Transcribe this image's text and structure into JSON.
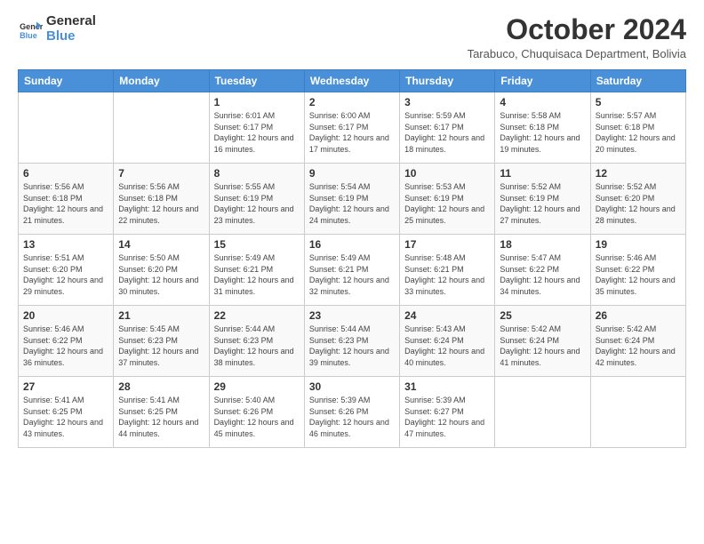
{
  "logo": {
    "line1": "General",
    "line2": "Blue"
  },
  "header": {
    "month": "October 2024",
    "subtitle": "Tarabuco, Chuquisaca Department, Bolivia"
  },
  "weekdays": [
    "Sunday",
    "Monday",
    "Tuesday",
    "Wednesday",
    "Thursday",
    "Friday",
    "Saturday"
  ],
  "weeks": [
    [
      {
        "day": "",
        "sunrise": "",
        "sunset": "",
        "daylight": ""
      },
      {
        "day": "",
        "sunrise": "",
        "sunset": "",
        "daylight": ""
      },
      {
        "day": "1",
        "sunrise": "Sunrise: 6:01 AM",
        "sunset": "Sunset: 6:17 PM",
        "daylight": "Daylight: 12 hours and 16 minutes."
      },
      {
        "day": "2",
        "sunrise": "Sunrise: 6:00 AM",
        "sunset": "Sunset: 6:17 PM",
        "daylight": "Daylight: 12 hours and 17 minutes."
      },
      {
        "day": "3",
        "sunrise": "Sunrise: 5:59 AM",
        "sunset": "Sunset: 6:17 PM",
        "daylight": "Daylight: 12 hours and 18 minutes."
      },
      {
        "day": "4",
        "sunrise": "Sunrise: 5:58 AM",
        "sunset": "Sunset: 6:18 PM",
        "daylight": "Daylight: 12 hours and 19 minutes."
      },
      {
        "day": "5",
        "sunrise": "Sunrise: 5:57 AM",
        "sunset": "Sunset: 6:18 PM",
        "daylight": "Daylight: 12 hours and 20 minutes."
      }
    ],
    [
      {
        "day": "6",
        "sunrise": "Sunrise: 5:56 AM",
        "sunset": "Sunset: 6:18 PM",
        "daylight": "Daylight: 12 hours and 21 minutes."
      },
      {
        "day": "7",
        "sunrise": "Sunrise: 5:56 AM",
        "sunset": "Sunset: 6:18 PM",
        "daylight": "Daylight: 12 hours and 22 minutes."
      },
      {
        "day": "8",
        "sunrise": "Sunrise: 5:55 AM",
        "sunset": "Sunset: 6:19 PM",
        "daylight": "Daylight: 12 hours and 23 minutes."
      },
      {
        "day": "9",
        "sunrise": "Sunrise: 5:54 AM",
        "sunset": "Sunset: 6:19 PM",
        "daylight": "Daylight: 12 hours and 24 minutes."
      },
      {
        "day": "10",
        "sunrise": "Sunrise: 5:53 AM",
        "sunset": "Sunset: 6:19 PM",
        "daylight": "Daylight: 12 hours and 25 minutes."
      },
      {
        "day": "11",
        "sunrise": "Sunrise: 5:52 AM",
        "sunset": "Sunset: 6:19 PM",
        "daylight": "Daylight: 12 hours and 27 minutes."
      },
      {
        "day": "12",
        "sunrise": "Sunrise: 5:52 AM",
        "sunset": "Sunset: 6:20 PM",
        "daylight": "Daylight: 12 hours and 28 minutes."
      }
    ],
    [
      {
        "day": "13",
        "sunrise": "Sunrise: 5:51 AM",
        "sunset": "Sunset: 6:20 PM",
        "daylight": "Daylight: 12 hours and 29 minutes."
      },
      {
        "day": "14",
        "sunrise": "Sunrise: 5:50 AM",
        "sunset": "Sunset: 6:20 PM",
        "daylight": "Daylight: 12 hours and 30 minutes."
      },
      {
        "day": "15",
        "sunrise": "Sunrise: 5:49 AM",
        "sunset": "Sunset: 6:21 PM",
        "daylight": "Daylight: 12 hours and 31 minutes."
      },
      {
        "day": "16",
        "sunrise": "Sunrise: 5:49 AM",
        "sunset": "Sunset: 6:21 PM",
        "daylight": "Daylight: 12 hours and 32 minutes."
      },
      {
        "day": "17",
        "sunrise": "Sunrise: 5:48 AM",
        "sunset": "Sunset: 6:21 PM",
        "daylight": "Daylight: 12 hours and 33 minutes."
      },
      {
        "day": "18",
        "sunrise": "Sunrise: 5:47 AM",
        "sunset": "Sunset: 6:22 PM",
        "daylight": "Daylight: 12 hours and 34 minutes."
      },
      {
        "day": "19",
        "sunrise": "Sunrise: 5:46 AM",
        "sunset": "Sunset: 6:22 PM",
        "daylight": "Daylight: 12 hours and 35 minutes."
      }
    ],
    [
      {
        "day": "20",
        "sunrise": "Sunrise: 5:46 AM",
        "sunset": "Sunset: 6:22 PM",
        "daylight": "Daylight: 12 hours and 36 minutes."
      },
      {
        "day": "21",
        "sunrise": "Sunrise: 5:45 AM",
        "sunset": "Sunset: 6:23 PM",
        "daylight": "Daylight: 12 hours and 37 minutes."
      },
      {
        "day": "22",
        "sunrise": "Sunrise: 5:44 AM",
        "sunset": "Sunset: 6:23 PM",
        "daylight": "Daylight: 12 hours and 38 minutes."
      },
      {
        "day": "23",
        "sunrise": "Sunrise: 5:44 AM",
        "sunset": "Sunset: 6:23 PM",
        "daylight": "Daylight: 12 hours and 39 minutes."
      },
      {
        "day": "24",
        "sunrise": "Sunrise: 5:43 AM",
        "sunset": "Sunset: 6:24 PM",
        "daylight": "Daylight: 12 hours and 40 minutes."
      },
      {
        "day": "25",
        "sunrise": "Sunrise: 5:42 AM",
        "sunset": "Sunset: 6:24 PM",
        "daylight": "Daylight: 12 hours and 41 minutes."
      },
      {
        "day": "26",
        "sunrise": "Sunrise: 5:42 AM",
        "sunset": "Sunset: 6:24 PM",
        "daylight": "Daylight: 12 hours and 42 minutes."
      }
    ],
    [
      {
        "day": "27",
        "sunrise": "Sunrise: 5:41 AM",
        "sunset": "Sunset: 6:25 PM",
        "daylight": "Daylight: 12 hours and 43 minutes."
      },
      {
        "day": "28",
        "sunrise": "Sunrise: 5:41 AM",
        "sunset": "Sunset: 6:25 PM",
        "daylight": "Daylight: 12 hours and 44 minutes."
      },
      {
        "day": "29",
        "sunrise": "Sunrise: 5:40 AM",
        "sunset": "Sunset: 6:26 PM",
        "daylight": "Daylight: 12 hours and 45 minutes."
      },
      {
        "day": "30",
        "sunrise": "Sunrise: 5:39 AM",
        "sunset": "Sunset: 6:26 PM",
        "daylight": "Daylight: 12 hours and 46 minutes."
      },
      {
        "day": "31",
        "sunrise": "Sunrise: 5:39 AM",
        "sunset": "Sunset: 6:27 PM",
        "daylight": "Daylight: 12 hours and 47 minutes."
      },
      {
        "day": "",
        "sunrise": "",
        "sunset": "",
        "daylight": ""
      },
      {
        "day": "",
        "sunrise": "",
        "sunset": "",
        "daylight": ""
      }
    ]
  ]
}
